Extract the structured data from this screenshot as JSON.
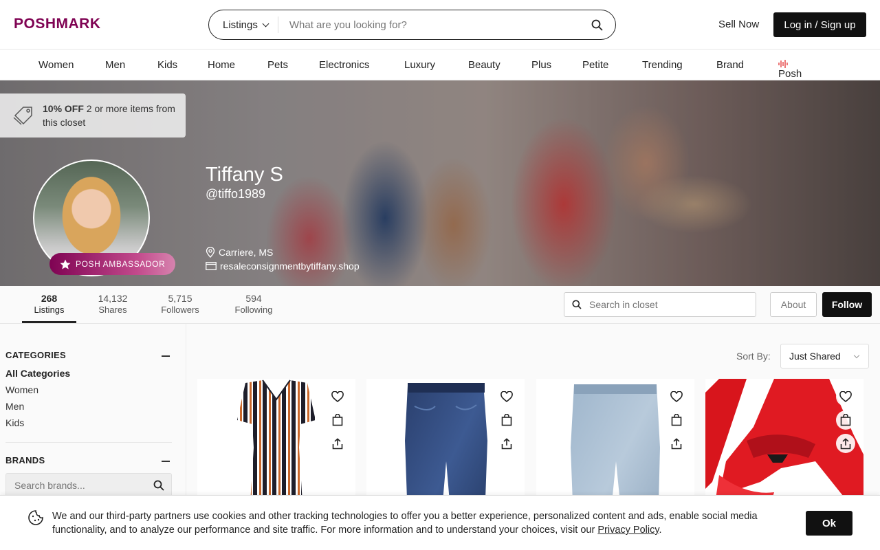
{
  "header": {
    "logo": "POSHMARK",
    "search_scope": "Listings",
    "search_placeholder": "What are you looking for?",
    "sell_now": "Sell Now",
    "login": "Log in / Sign up"
  },
  "category_nav": [
    "Women",
    "Men",
    "Kids",
    "Home",
    "Pets",
    "Electronics",
    "Luxury",
    "Beauty",
    "Plus",
    "Petite",
    "Trending",
    "Brand"
  ],
  "posh_live": "Posh Live",
  "banner": {
    "discount_bold": "10% OFF",
    "discount_text": "2 or more items from this closet",
    "badge": "POSH AMBASSADOR",
    "name": "Tiffany S",
    "handle": "@tiffo1989",
    "location": "Carriere, MS",
    "website": "resaleconsignmentbytiffany.shop"
  },
  "stats": [
    {
      "value": "268",
      "label": "Listings"
    },
    {
      "value": "14,132",
      "label": "Shares"
    },
    {
      "value": "5,715",
      "label": "Followers"
    },
    {
      "value": "594",
      "label": "Following"
    }
  ],
  "closet_search_placeholder": "Search in closet",
  "about": "About",
  "follow": "Follow",
  "sidebar": {
    "categories_title": "CATEGORIES",
    "categories": [
      "All Categories",
      "Women",
      "Men",
      "Kids"
    ],
    "brands_title": "BRANDS",
    "brand_search_placeholder": "Search brands..."
  },
  "sort": {
    "label": "Sort By:",
    "value": "Just Shared"
  },
  "listings": [
    {
      "item": "striped-romper"
    },
    {
      "item": "dark-jeans"
    },
    {
      "item": "light-jeans"
    },
    {
      "item": "red-lace-lingerie"
    }
  ],
  "cookie": {
    "text": "We and our third-party partners use cookies and other tracking technologies to offer you a better experience, personalized content and ads, enable social media functionality, and to analyze our performance and site traffic. For more information and to understand your choices, visit our ",
    "link": "Privacy Policy",
    "end": ".",
    "ok": "Ok"
  }
}
